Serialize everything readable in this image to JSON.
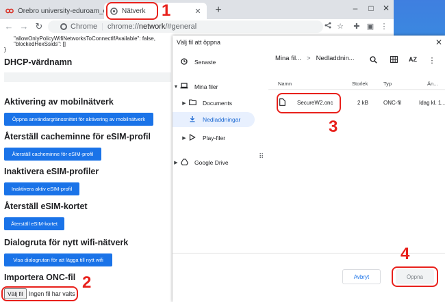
{
  "browser": {
    "tabs": [
      {
        "title": "Örebro university-eduroam_oru |"
      },
      {
        "title": "Nätverk"
      }
    ],
    "new_tab": "+",
    "window_controls": [
      "–",
      "□",
      "✕"
    ],
    "toolbar": {
      "back": "←",
      "forward": "→",
      "reload": "↻",
      "scheme": "Chrome",
      "divider": "|",
      "url_prefix": "chrome://",
      "url_host": "network",
      "url_path": "/#general"
    }
  },
  "page": {
    "code_lines": [
      "\"allowOnlyPolicyWifiNetworksToConnectIfAvailable\": false,",
      "\"blockedHexSsids\": []",
      "}"
    ],
    "sections": [
      {
        "heading": "DHCP-värdnamn"
      },
      {
        "heading": "Aktivering av mobilnätverk",
        "button": "Öppna användargränssnittet för aktivering av mobilnätverk"
      },
      {
        "heading": "Återställ cacheminne för eSIM-profil",
        "button": "Återställ cacheminne för eSIM-profil"
      },
      {
        "heading": "Inaktivera eSIM-profiler",
        "button": "Inaktivera aktiv eSIM-profil"
      },
      {
        "heading": "Återställ eSIM-kortet",
        "button": "Återställ eSIM-kortet"
      },
      {
        "heading": "Dialogruta för nytt wifi-nätverk",
        "button": "Visa dialogrutan för att lägga till nytt wifi"
      },
      {
        "heading": "Importera ONC-fil"
      }
    ],
    "file_input": {
      "button": "Välj fil",
      "status": "Ingen fil har valts"
    }
  },
  "dialog": {
    "title": "Välj fil att öppna",
    "close": "✕",
    "sidebar": {
      "recent": "Senaste",
      "my_files": "Mina filer",
      "documents": "Documents",
      "downloads": "Nedladdningar",
      "play_files": "Play-filer",
      "google_drive": "Google Drive"
    },
    "breadcrumb": [
      "Mina fil...",
      "Nedladdnin..."
    ],
    "breadcrumb_sep": ">",
    "columns": {
      "name": "Namn",
      "size": "Storlek",
      "type": "Typ",
      "date": "Än..."
    },
    "file": {
      "name": "SecureW2.onc",
      "size": "2 kB",
      "type": "ONC-fil",
      "date": "Idag kl. 1..."
    },
    "cancel": "Avbryt",
    "open": "Öppna"
  },
  "annotations": [
    "1",
    "2",
    "3",
    "4"
  ],
  "colors": {
    "annotation": "#e8201b",
    "accent": "#1a73e8",
    "selected_bg": "#e8f0fe"
  }
}
